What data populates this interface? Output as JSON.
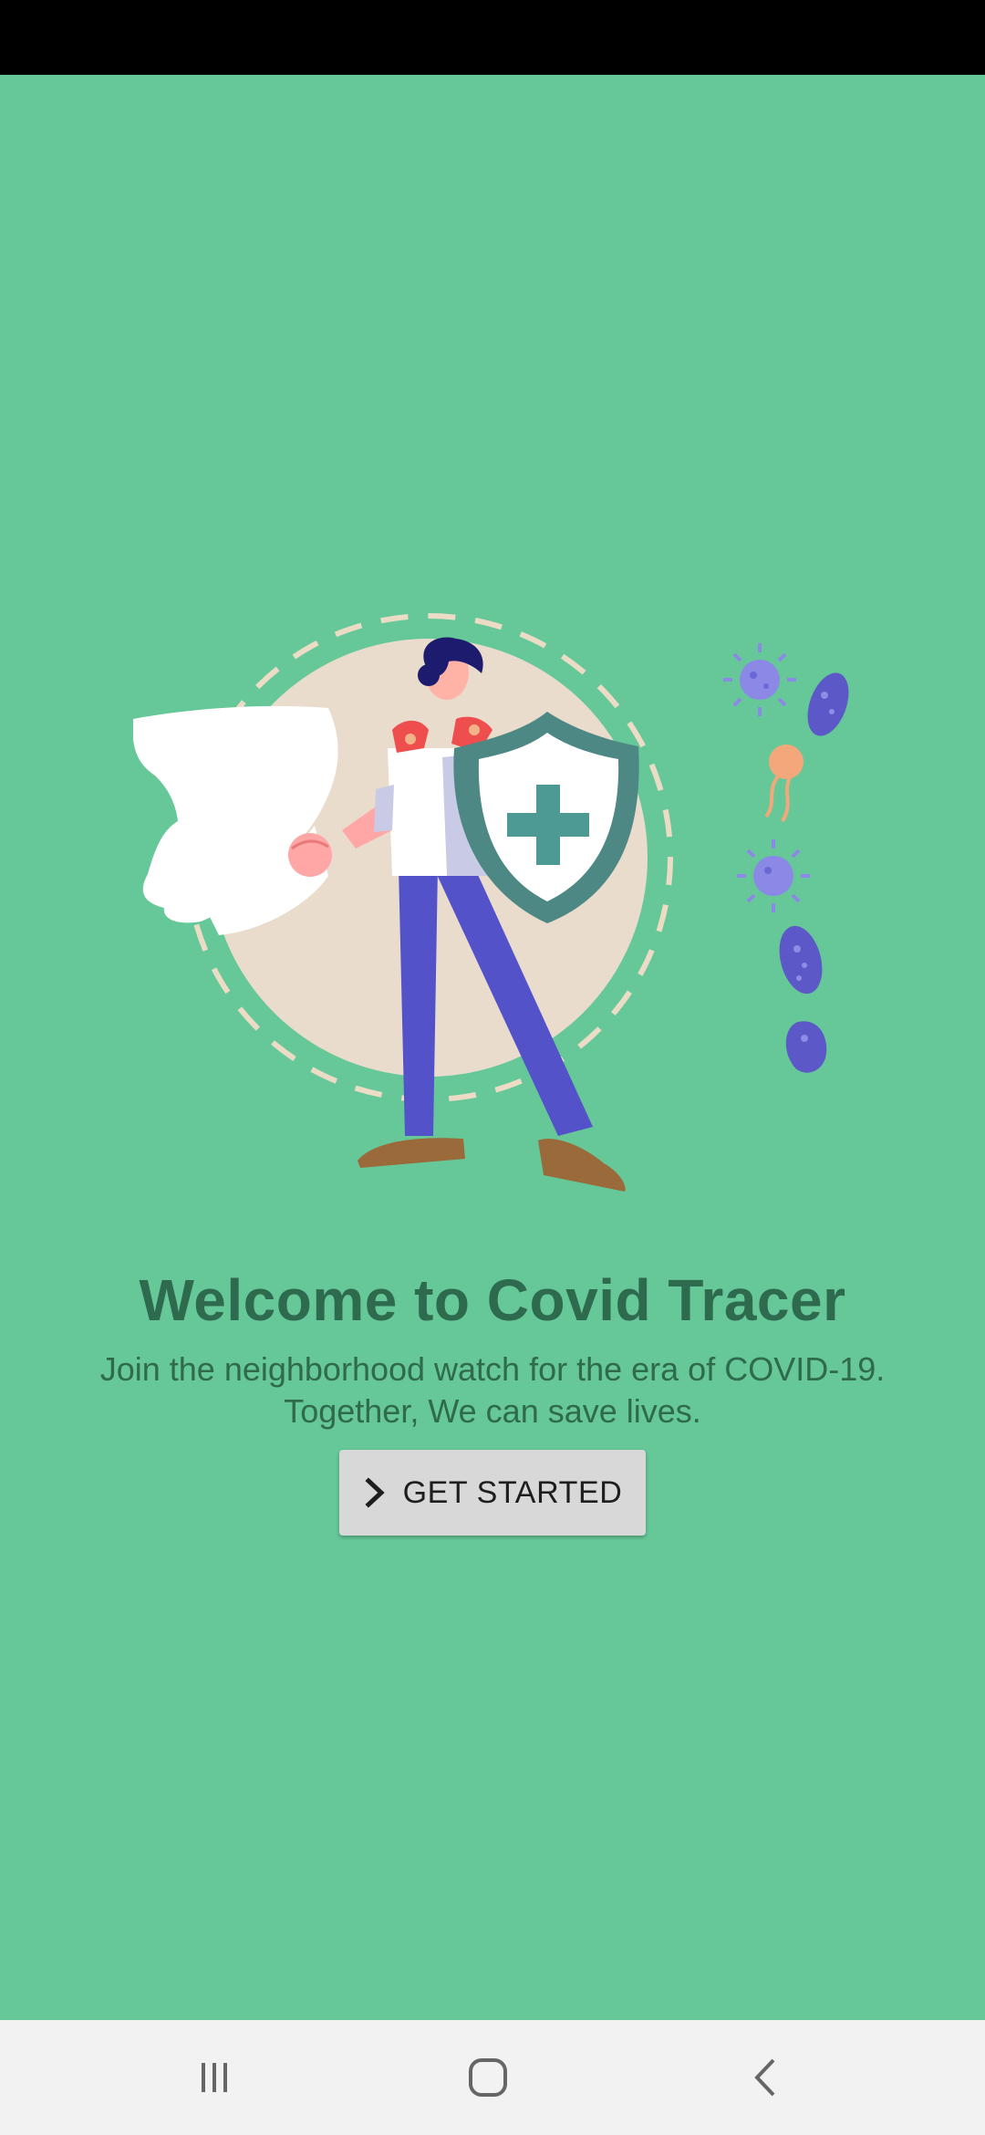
{
  "welcome": {
    "title": "Welcome to Covid Tracer",
    "subtitle_line1": "Join the neighborhood watch for the era of COVID-19.",
    "subtitle_line2": "Together, We can save lives."
  },
  "cta": {
    "label": "GET STARTED",
    "icon": "chevron-right-icon"
  },
  "illustration": {
    "subject": "superhero-with-shield",
    "icons": [
      "shield-plus-icon",
      "virus-icon",
      "bacteria-icon"
    ]
  },
  "navigation": {
    "recents_icon": "recent-apps-icon",
    "home_icon": "home-icon",
    "back_icon": "back-icon"
  },
  "colors": {
    "background": "#66c898",
    "title": "#2e6a4d",
    "button": "#d8d8d8",
    "status_bar": "#000000",
    "nav_bar": "#f2f2f2"
  }
}
